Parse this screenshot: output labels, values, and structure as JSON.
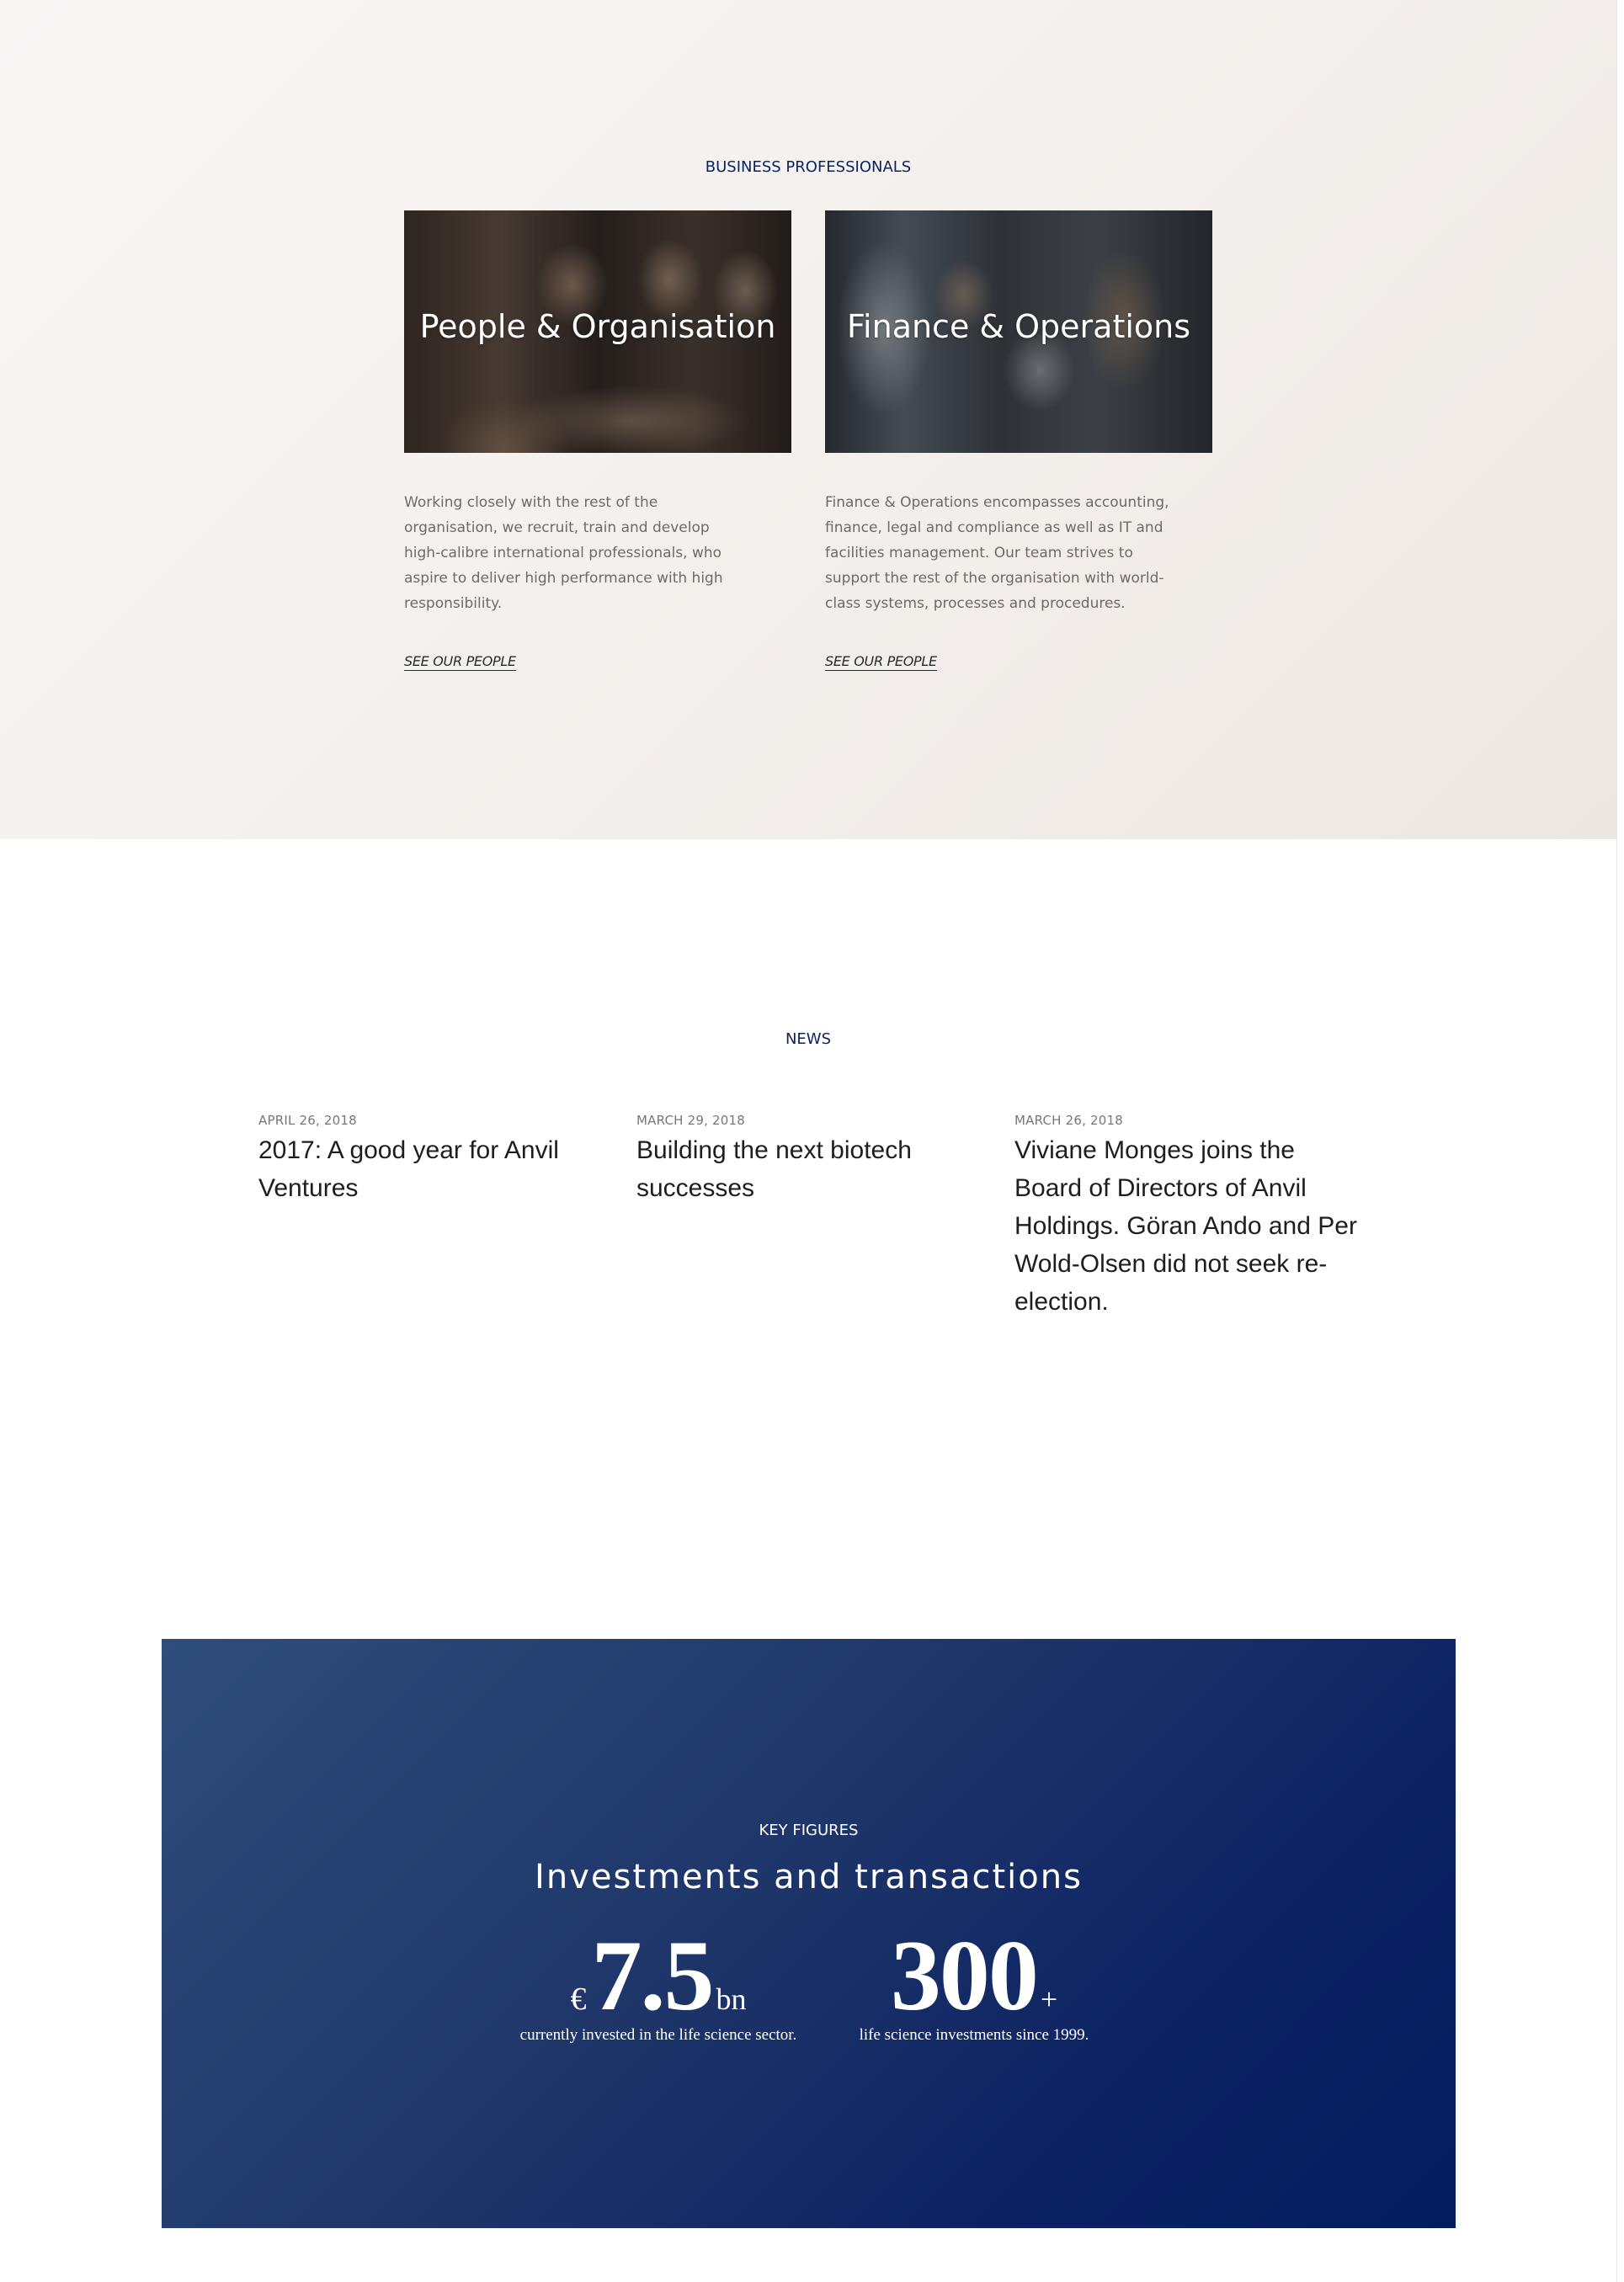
{
  "business_professionals": {
    "eyebrow": "BUSINESS PROFESSIONALS",
    "cards": [
      {
        "title": "People & Organisation",
        "image": "office-meeting-photo",
        "text": "Working closely with the rest of the organisation, we recruit, train and develop high-calibre international professionals, who aspire to deliver high performance with high responsibility.",
        "link": "SEE OUR PEOPLE"
      },
      {
        "title": "Finance & Operations",
        "image": "office-team-photo",
        "text": "Finance & Operations encompasses accounting, finance, legal and compliance as well as IT and facilities management. Our team strives to support the rest of the organisation with world-class systems, processes and procedures.",
        "link": "SEE OUR PEOPLE"
      }
    ]
  },
  "news": {
    "eyebrow": "NEWS",
    "items": [
      {
        "date": "APRIL 26, 2018",
        "title": "2017: A good year for Anvil Ventures"
      },
      {
        "date": "MARCH 29, 2018",
        "title": "Building the next biotech successes"
      },
      {
        "date": "MARCH 26, 2018",
        "title": "Viviane Monges joins the Board of Directors of Anvil Holdings. Göran Ando and Per Wold-Olsen did not seek re-election."
      }
    ]
  },
  "key_figures": {
    "eyebrow": "KEY FIGURES",
    "heading": "Investments and transactions",
    "figures": [
      {
        "prefix": "€",
        "value": "7.5",
        "suffix": "bn",
        "caption": "currently invested in the life science sector."
      },
      {
        "prefix": "",
        "value": "300",
        "suffix": "+",
        "caption": "life science investments since 1999."
      }
    ]
  },
  "colors": {
    "navy": "#0b2461",
    "section_bg": "#f3efec",
    "key_figures_bg": "#1e3569"
  }
}
